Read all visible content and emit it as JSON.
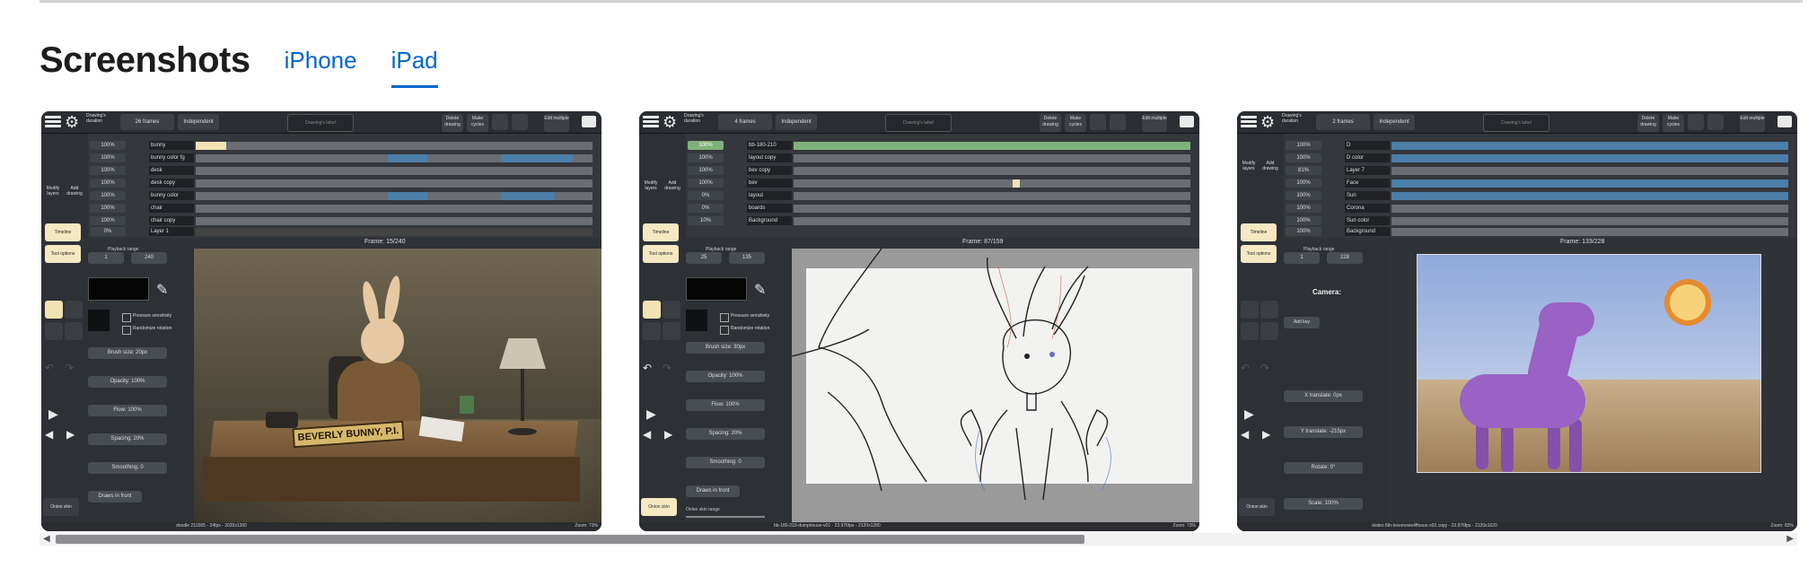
{
  "section": {
    "title": "Screenshots",
    "tabs": [
      {
        "label": "iPhone",
        "active": false
      },
      {
        "label": "iPad",
        "active": true
      }
    ]
  },
  "scrollbar": {
    "left_arrow": "◀",
    "right_arrow": "▶"
  },
  "colors": {
    "accent": "#0066cc",
    "app_chrome": "#2b2e33",
    "highlight": "#f3e2b2"
  },
  "shot1": {
    "duration_label": "Drawing's duration",
    "frames": "26 frames",
    "mode": "Independent",
    "drawing_label": "Drawing's label",
    "delete_label": "Delete drawing",
    "cycles_label": "Make cycles",
    "edit_label": "Edit multiple",
    "modify_layers": "Modify layers",
    "add_drawing": "Add drawing",
    "timeline": "Timeline",
    "tool_options": "Tool options",
    "layers": [
      {
        "pct": "100%",
        "name": "bunny"
      },
      {
        "pct": "100%",
        "name": "bunny color fg"
      },
      {
        "pct": "100%",
        "name": "desk"
      },
      {
        "pct": "100%",
        "name": "desk copy"
      },
      {
        "pct": "100%",
        "name": "bunny color"
      },
      {
        "pct": "100%",
        "name": "chair"
      },
      {
        "pct": "100%",
        "name": "chair copy"
      },
      {
        "pct": "0%",
        "name": "Layer 1"
      }
    ],
    "playback_label": "Playback range",
    "range_start": "1",
    "range_end": "240",
    "frame_label": "Frame: 15/240",
    "pressure": "Pressure sensitivity",
    "randomize": "Randomize rotation",
    "brush_size": "Brush size: 20px",
    "opacity": "Opacity: 100%",
    "flow": "Flow: 100%",
    "spacing": "Spacing: 20%",
    "smoothing": "Smoothing: 0",
    "draws_in_front": "Draws in front",
    "onion_skin": "Onion skin",
    "plate": "BEVERLY BUNNY, P.I.",
    "status": "doodle 210305 - 24fps - 2020x1260",
    "zoom": "Zoom: 73%"
  },
  "shot2": {
    "duration_label": "Drawing's duration",
    "frames": "4 frames",
    "mode": "Independent",
    "drawing_label": "Drawing's label",
    "delete_label": "Delete drawing",
    "cycles_label": "Make cycles",
    "edit_label": "Edit multiple",
    "modify_layers": "Modify layers",
    "add_drawing": "Add drawing",
    "timeline": "Timeline",
    "tool_options": "Tool options",
    "layers": [
      {
        "pct": "100%",
        "name": "bb-180-210"
      },
      {
        "pct": "100%",
        "name": "layout copy"
      },
      {
        "pct": "100%",
        "name": "bev copy"
      },
      {
        "pct": "100%",
        "name": "bev"
      },
      {
        "pct": "0%",
        "name": "layout"
      },
      {
        "pct": "0%",
        "name": "boards"
      },
      {
        "pct": "10%",
        "name": "Background"
      }
    ],
    "playback_label": "Playback range",
    "range_start": "25",
    "range_end": "135",
    "frame_label": "Frame: 87/159",
    "pressure": "Pressure sensitivity",
    "randomize": "Randomize rotation",
    "brush_size": "Brush size: 30px",
    "opacity": "Opacity: 100%",
    "flow": "Flow: 100%",
    "spacing": "Spacing: 20%",
    "smoothing": "Smoothing: 0",
    "draws_in_front": "Draws in front",
    "onion_skin": "Onion skin",
    "onion_range": "Onion skin range",
    "status": "bb-180-210-dumphouse-v01 - 23.976fps - 2120x1280",
    "zoom": "Zoom: 73%"
  },
  "shot3": {
    "duration_label": "Drawing's duration",
    "frames": "2 frames",
    "mode": "Independent",
    "drawing_label": "Drawing's label",
    "delete_label": "Delete drawing",
    "cycles_label": "Make cycles",
    "edit_label": "Edit multiple",
    "modify_layers": "Modify layers",
    "add_drawing": "Add drawing",
    "timeline": "Timeline",
    "tool_options": "Tool options",
    "layers": [
      {
        "pct": "100%",
        "name": "D"
      },
      {
        "pct": "100%",
        "name": "D color"
      },
      {
        "pct": "81%",
        "name": "Layer 7"
      },
      {
        "pct": "100%",
        "name": "Face"
      },
      {
        "pct": "100%",
        "name": "Sun"
      },
      {
        "pct": "100%",
        "name": "Corona"
      },
      {
        "pct": "100%",
        "name": "Sun color"
      },
      {
        "pct": "100%",
        "name": "Background"
      }
    ],
    "playback_label": "Playback range",
    "range_start": "1",
    "range_end": "228",
    "frame_label": "Frame: 133/228",
    "camera": "Camera:",
    "add_key": "Add key",
    "x_translate": "X translate: 0px",
    "y_translate": "Y translate: -215px",
    "rotate": "Rotate: 0°",
    "scale": "Scale: 100%",
    "onion_skin": "Onion skin",
    "status": "dvdeo 6th-lovemovie4ffosun-v03 copy - 23.976fps - 2120x1620",
    "zoom": "Zoom: 83%"
  }
}
